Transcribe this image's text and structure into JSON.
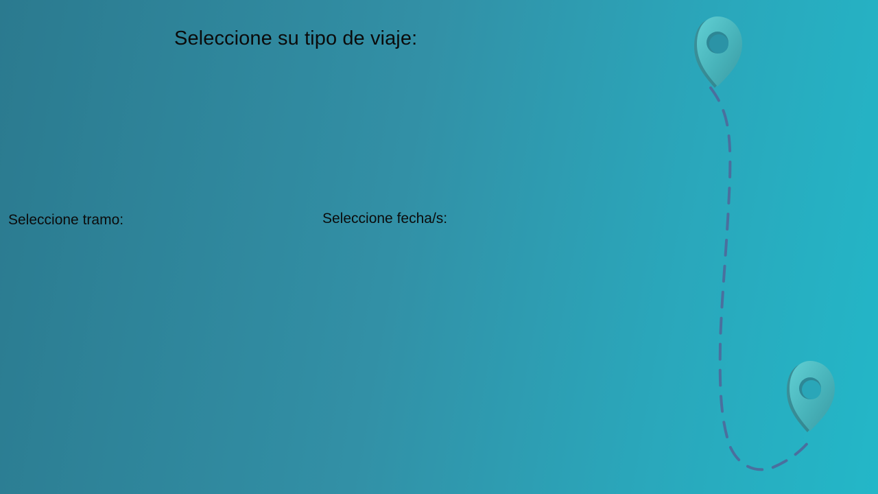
{
  "page": {
    "heading": "Seleccione su tipo de viaje:"
  },
  "form": {
    "segment_label": "Seleccione tramo:",
    "date_label": "Seleccione fecha/s:"
  },
  "decoration": {
    "icons": [
      "map-pin-icon",
      "map-pin-icon"
    ],
    "route_color": "#4a6f9e",
    "pin_color": "#4fc2c8"
  },
  "colors": {
    "background_start": "#2b7a8f",
    "background_end": "#23b7c8",
    "text": "#0b0b0b"
  }
}
